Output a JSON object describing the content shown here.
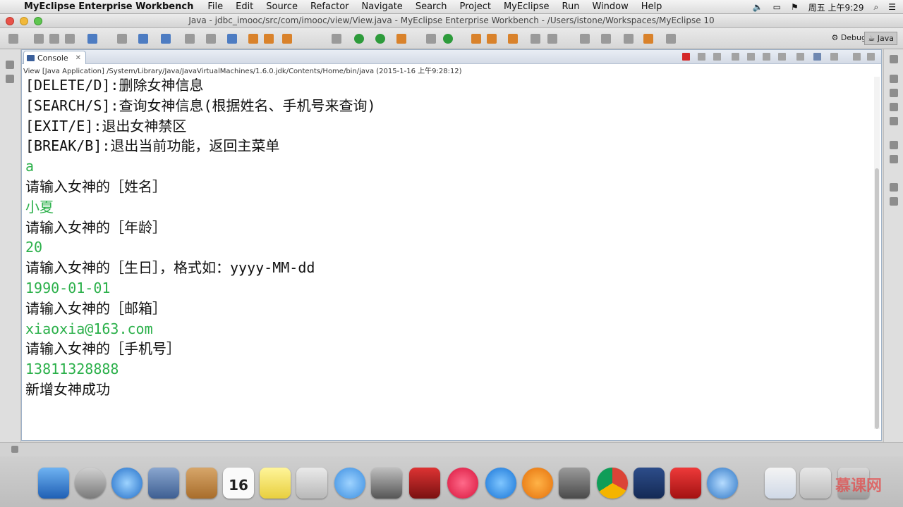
{
  "menubar": {
    "app_name": "MyEclipse Enterprise Workbench",
    "menus": [
      "File",
      "Edit",
      "Source",
      "Refactor",
      "Navigate",
      "Search",
      "Project",
      "MyEclipse",
      "Run",
      "Window",
      "Help"
    ],
    "clock": "周五 上午9:29"
  },
  "window": {
    "title": "Java - jdbc_imooc/src/com/imooc/view/View.java - MyEclipse Enterprise Workbench - /Users/istone/Workspaces/MyEclipse 10"
  },
  "toolbar": {
    "perspective_debug": "Debug",
    "perspective_java": "Java"
  },
  "console": {
    "tab_label": "Console",
    "close_glyph": "✕",
    "launch_path": "View [Java Application] /System/Library/Java/JavaVirtualMachines/1.6.0.jdk/Contents/Home/bin/java (2015-1-16 上午9:28:12)",
    "lines": [
      {
        "text": "[DELETE/D]:删除女神信息",
        "kind": "out"
      },
      {
        "text": "[SEARCH/S]:查询女神信息(根据姓名、手机号来查询)",
        "kind": "out"
      },
      {
        "text": "[EXIT/E]:退出女神禁区",
        "kind": "out"
      },
      {
        "text": "[BREAK/B]:退出当前功能，返回主菜单",
        "kind": "out"
      },
      {
        "text": "a",
        "kind": "in"
      },
      {
        "text": "请输入女神的［姓名］",
        "kind": "out"
      },
      {
        "text": "小夏",
        "kind": "in"
      },
      {
        "text": "请输入女神的［年龄］",
        "kind": "out"
      },
      {
        "text": "20",
        "kind": "in"
      },
      {
        "text": "请输入女神的［生日］，格式如：yyyy-MM-dd",
        "kind": "out"
      },
      {
        "text": "1990-01-01",
        "kind": "in"
      },
      {
        "text": "请输入女神的［邮箱］",
        "kind": "out"
      },
      {
        "text": "xiaoxia@163.com",
        "kind": "in"
      },
      {
        "text": "请输入女神的［手机号］",
        "kind": "out"
      },
      {
        "text": "13811328888",
        "kind": "in"
      },
      {
        "text": "新增女神成功",
        "kind": "out"
      }
    ]
  },
  "dock": {
    "calendar_day": "16",
    "watermark": "慕课网"
  },
  "colors": {
    "stdout": "#111111",
    "stdin": "#2bb04a",
    "terminate": "#d42828"
  }
}
